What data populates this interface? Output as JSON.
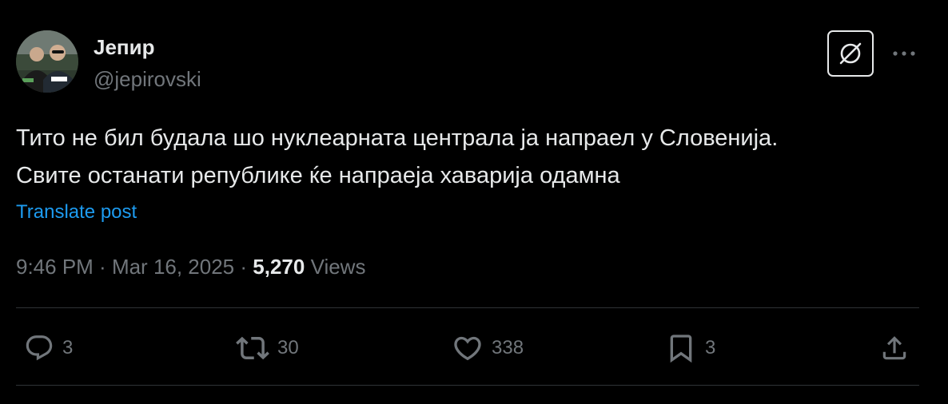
{
  "author": {
    "name": "Јепир",
    "handle": "@jepirovski",
    "avatar_icon": "profile-photo"
  },
  "tweet": {
    "lines": [
      "Тито не бил будала шо нуклеарната централа ја напраел у Словенија.",
      "Свите останати републике ќе напраеја хаварија одамна"
    ],
    "translate_label": "Translate post"
  },
  "meta": {
    "time": "9:46 PM",
    "separator": " · ",
    "date": "Mar 16, 2025",
    "views_count": "5,270",
    "views_label": "Views"
  },
  "actions": {
    "replies": "3",
    "reposts": "30",
    "likes": "338",
    "bookmarks": "3"
  },
  "icons": {
    "grok": "grok-icon",
    "more": "more-icon",
    "reply": "reply-icon",
    "repost": "repost-icon",
    "like": "heart-icon",
    "bookmark": "bookmark-icon",
    "share": "share-icon"
  },
  "colors": {
    "background": "#000000",
    "text": "#e7e9ea",
    "muted": "#71767b",
    "link": "#1d9bf0",
    "divider": "#2f3336"
  }
}
